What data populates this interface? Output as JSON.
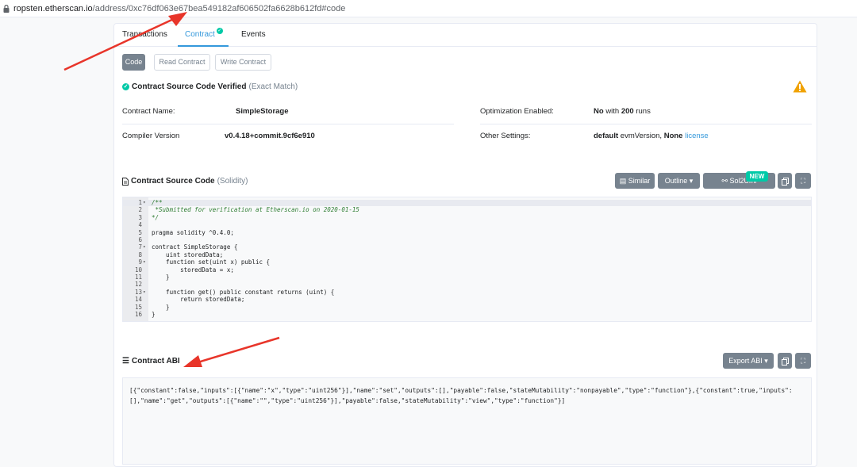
{
  "browser": {
    "url_domain": "ropsten.etherscan.io",
    "url_path": "/address/0xc76df063e67bea549182af606502fa6628b612fd#code"
  },
  "tabs": [
    {
      "label": "Transactions"
    },
    {
      "label": "Contract"
    },
    {
      "label": "Events"
    }
  ],
  "subtabs": {
    "code": "Code",
    "read": "Read Contract",
    "write": "Write Contract"
  },
  "verified": {
    "label": "Contract Source Code Verified",
    "note": "(Exact Match)"
  },
  "contract_info": {
    "name_label": "Contract Name:",
    "name_value": "SimpleStorage",
    "compiler_label": "Compiler Version",
    "compiler_value": "v0.4.18+commit.9cf6e910",
    "optimization_label": "Optimization Enabled:",
    "optimization_no": "No",
    "optimization_with": "with",
    "optimization_runs": "200",
    "optimization_runs_word": "runs",
    "other_label": "Other Settings:",
    "other_default": "default",
    "other_evm": "evmVersion,",
    "other_none": "None",
    "other_license": "license"
  },
  "source_section": {
    "title": "Contract Source Code",
    "lang": "(Solidity)",
    "similar": "Similar",
    "outline": "Outline",
    "sol2uml": "Sol2Uml",
    "new_badge": "NEW"
  },
  "code_lines": [
    {
      "no": "1",
      "fold": "▾",
      "text": "/**",
      "comment": true
    },
    {
      "no": "2",
      "fold": "",
      "text": " *Submitted for verification at Etherscan.io on 2020-01-15",
      "comment": true
    },
    {
      "no": "3",
      "fold": "",
      "text": "*/",
      "comment": true
    },
    {
      "no": "4",
      "fold": "",
      "text": "",
      "comment": false
    },
    {
      "no": "5",
      "fold": "",
      "text": "pragma solidity ^0.4.0;",
      "comment": false
    },
    {
      "no": "6",
      "fold": "",
      "text": "",
      "comment": false
    },
    {
      "no": "7",
      "fold": "▾",
      "text": "contract SimpleStorage {",
      "comment": false
    },
    {
      "no": "8",
      "fold": "",
      "text": "    uint storedData;",
      "comment": false
    },
    {
      "no": "9",
      "fold": "▾",
      "text": "    function set(uint x) public {",
      "comment": false
    },
    {
      "no": "10",
      "fold": "",
      "text": "        storedData = x;",
      "comment": false
    },
    {
      "no": "11",
      "fold": "",
      "text": "    }",
      "comment": false
    },
    {
      "no": "12",
      "fold": "",
      "text": "",
      "comment": false
    },
    {
      "no": "13",
      "fold": "▾",
      "text": "    function get() public constant returns (uint) {",
      "comment": false
    },
    {
      "no": "14",
      "fold": "",
      "text": "        return storedData;",
      "comment": false
    },
    {
      "no": "15",
      "fold": "",
      "text": "    }",
      "comment": false
    },
    {
      "no": "16",
      "fold": "",
      "text": "}",
      "comment": false
    }
  ],
  "abi_section": {
    "title": "Contract ABI",
    "export": "Export ABI",
    "text": "[{\"constant\":false,\"inputs\":[{\"name\":\"x\",\"type\":\"uint256\"}],\"name\":\"set\",\"outputs\":[],\"payable\":false,\"stateMutability\":\"nonpayable\",\"type\":\"function\"},{\"constant\":true,\"inputs\":[],\"name\":\"get\",\"outputs\":[{\"name\":\"\",\"type\":\"uint256\"}],\"payable\":false,\"stateMutability\":\"view\",\"type\":\"function\"}]"
  },
  "colors": {
    "accent": "#3498db",
    "success": "#00c9a7",
    "warning": "#f0a202",
    "annotation_arrow": "#e8352a"
  }
}
